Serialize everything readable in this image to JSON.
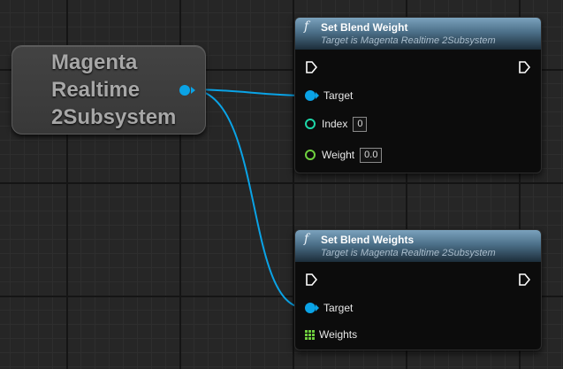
{
  "getter": {
    "title": "Magenta\nRealtime\n2Subsystem"
  },
  "nodes": [
    {
      "title": "Set Blend Weight",
      "subtitle": "Target is Magenta Realtime 2Subsystem",
      "pins": {
        "target_label": "Target",
        "index_label": "Index",
        "index_value": "0",
        "weight_label": "Weight",
        "weight_value": "0.0"
      }
    },
    {
      "title": "Set Blend Weights",
      "subtitle": "Target is Magenta Realtime 2Subsystem",
      "pins": {
        "target_label": "Target",
        "weights_label": "Weights"
      }
    }
  ],
  "icons": {
    "function": "f",
    "exec": "exec-pin-icon",
    "object": "object-pin-icon",
    "integer": "integer-pin-icon",
    "float": "float-pin-icon",
    "array": "array-pin-icon"
  },
  "colors": {
    "object_pin": "#0aa3e6",
    "integer_pin": "#1ed6a8",
    "float_pin": "#6fd03f",
    "header": "#4c7089"
  }
}
